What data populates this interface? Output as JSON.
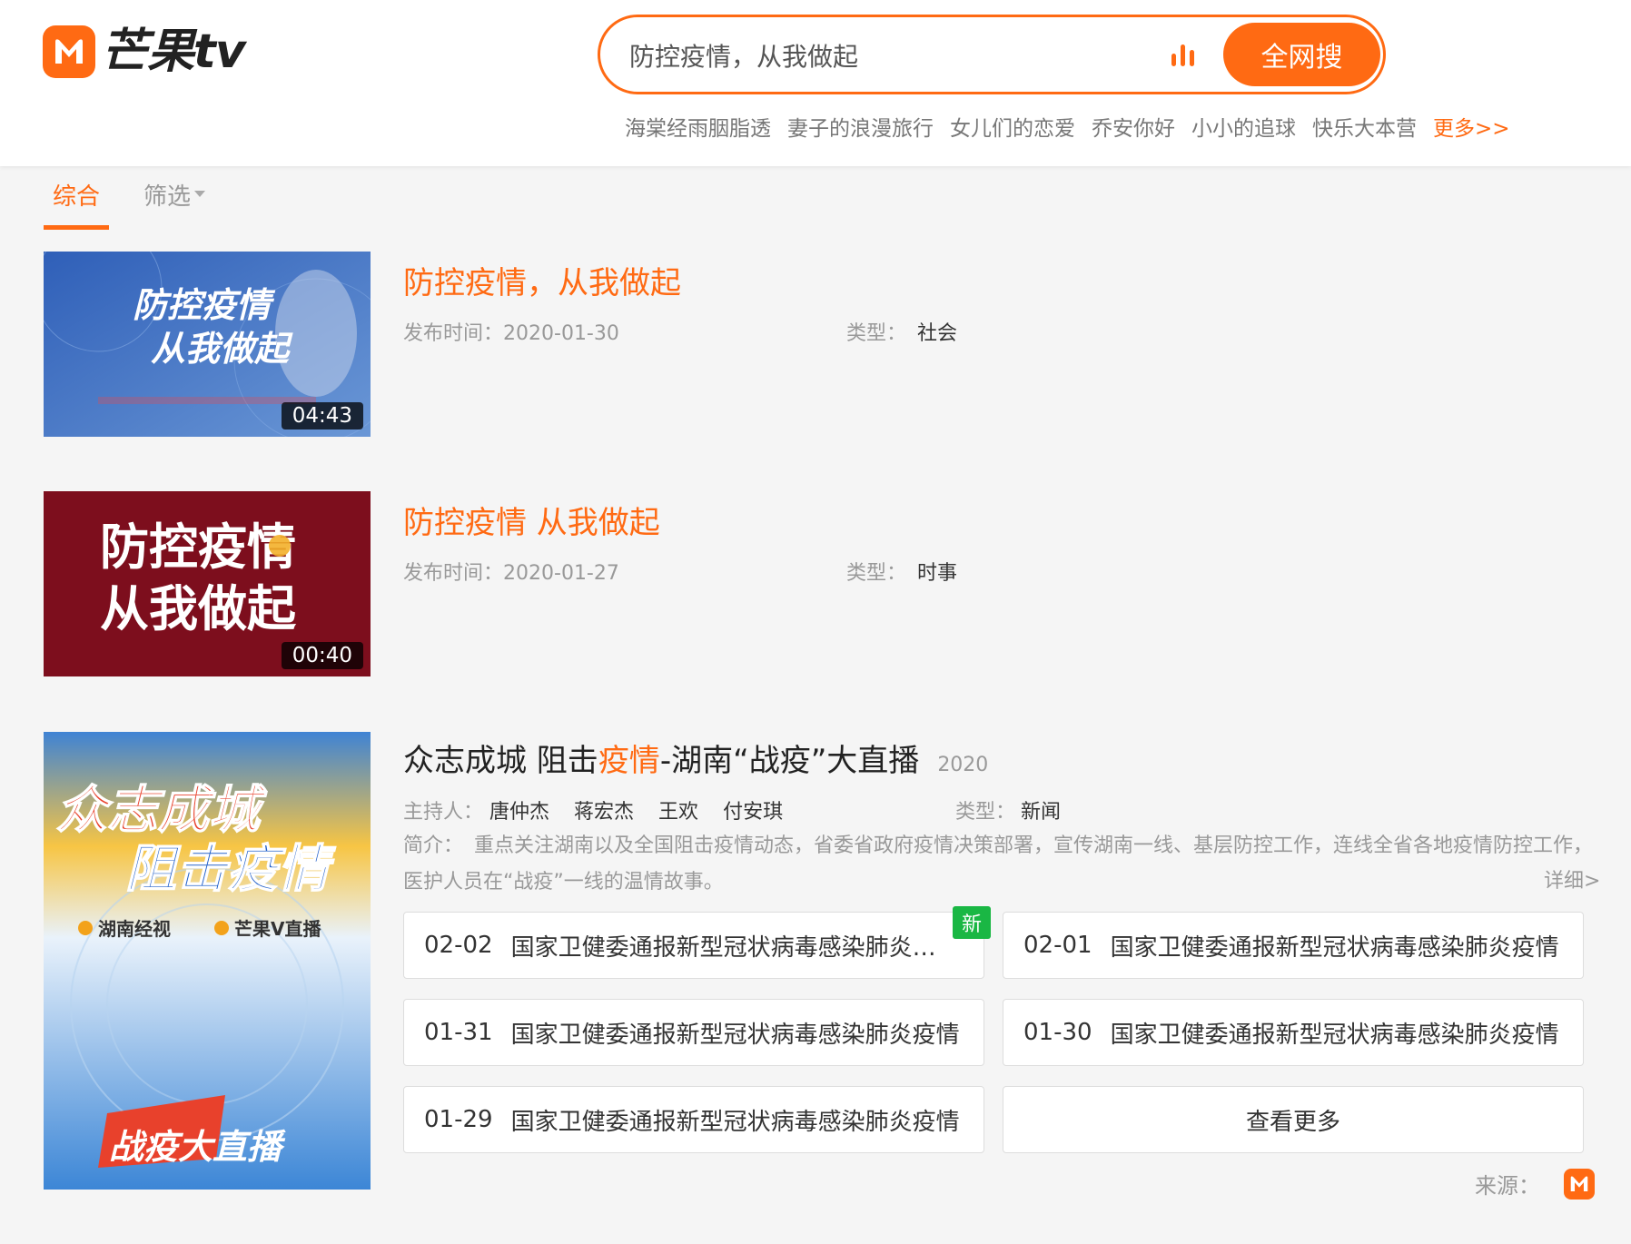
{
  "header": {
    "logo_text": "芒果tv",
    "search": {
      "value": "防控疫情，从我做起",
      "button_label": "全网搜"
    },
    "hot_words": [
      "海棠经雨胭脂透",
      "妻子的浪漫旅行",
      "女儿们的恋爱",
      "乔安你好",
      "小小的追球",
      "快乐大本营"
    ],
    "more_label": "更多>>"
  },
  "tabs": [
    {
      "label": "综合",
      "active": true
    },
    {
      "label": "筛选",
      "active": false
    }
  ],
  "results": [
    {
      "title": "防控疫情，从我做起",
      "duration": "04:43",
      "publish_label": "发布时间：",
      "publish_date": "2020-01-30",
      "type_label": "类型：",
      "type_value": "社会",
      "thumb_text_1": "防控疫情",
      "thumb_text_2": "从我做起"
    },
    {
      "title": "防控疫情 从我做起",
      "duration": "00:40",
      "publish_label": "发布时间：",
      "publish_date": "2020-01-27",
      "type_label": "类型：",
      "type_value": "时事",
      "thumb_text_1": "防控疫情",
      "thumb_text_2": "从我做起"
    }
  ],
  "show": {
    "title_part1": "众志成城 阻击",
    "title_highlight": "疫情",
    "title_part2": "-湖南“战疫”大直播",
    "year": "2020",
    "hosts_label": "主持人：",
    "hosts": [
      "唐仲杰",
      "蒋宏杰",
      "王欢",
      "付安琪"
    ],
    "type_label": "类型：",
    "type_value": "新闻",
    "desc_label": "简介：",
    "desc": "重点关注湖南以及全国阻击疫情动态，省委省政府疫情决策部署，宣传湖南一线、基层防控工作，连线全省各地疫情防控工作，医护人员在“战疫”一线的温情故事。",
    "detail_label": "详细>",
    "poster_text_1": "众志成城",
    "poster_text_2": "阻击疫情",
    "poster_brand_1": "湖南经视",
    "poster_brand_2": "芒果V直播",
    "poster_bottom": "战疫大直播",
    "new_badge": "新",
    "episodes": [
      {
        "date": "02-02",
        "title": "国家卫健委通报新型冠状病毒感染肺炎疫情"
      },
      {
        "date": "02-01",
        "title": "国家卫健委通报新型冠状病毒感染肺炎疫情"
      },
      {
        "date": "01-31",
        "title": "国家卫健委通报新型冠状病毒感染肺炎疫情"
      },
      {
        "date": "01-30",
        "title": "国家卫健委通报新型冠状病毒感染肺炎疫情"
      },
      {
        "date": "01-29",
        "title": "国家卫健委通报新型冠状病毒感染肺炎疫情"
      }
    ],
    "more_label": "查看更多",
    "source_label": "来源："
  },
  "colors": {
    "accent": "#ff6a13",
    "new_badge": "#1ab744"
  },
  "icons": [
    "mango-logo-icon",
    "voice-bars-icon",
    "chevron-down-icon"
  ]
}
